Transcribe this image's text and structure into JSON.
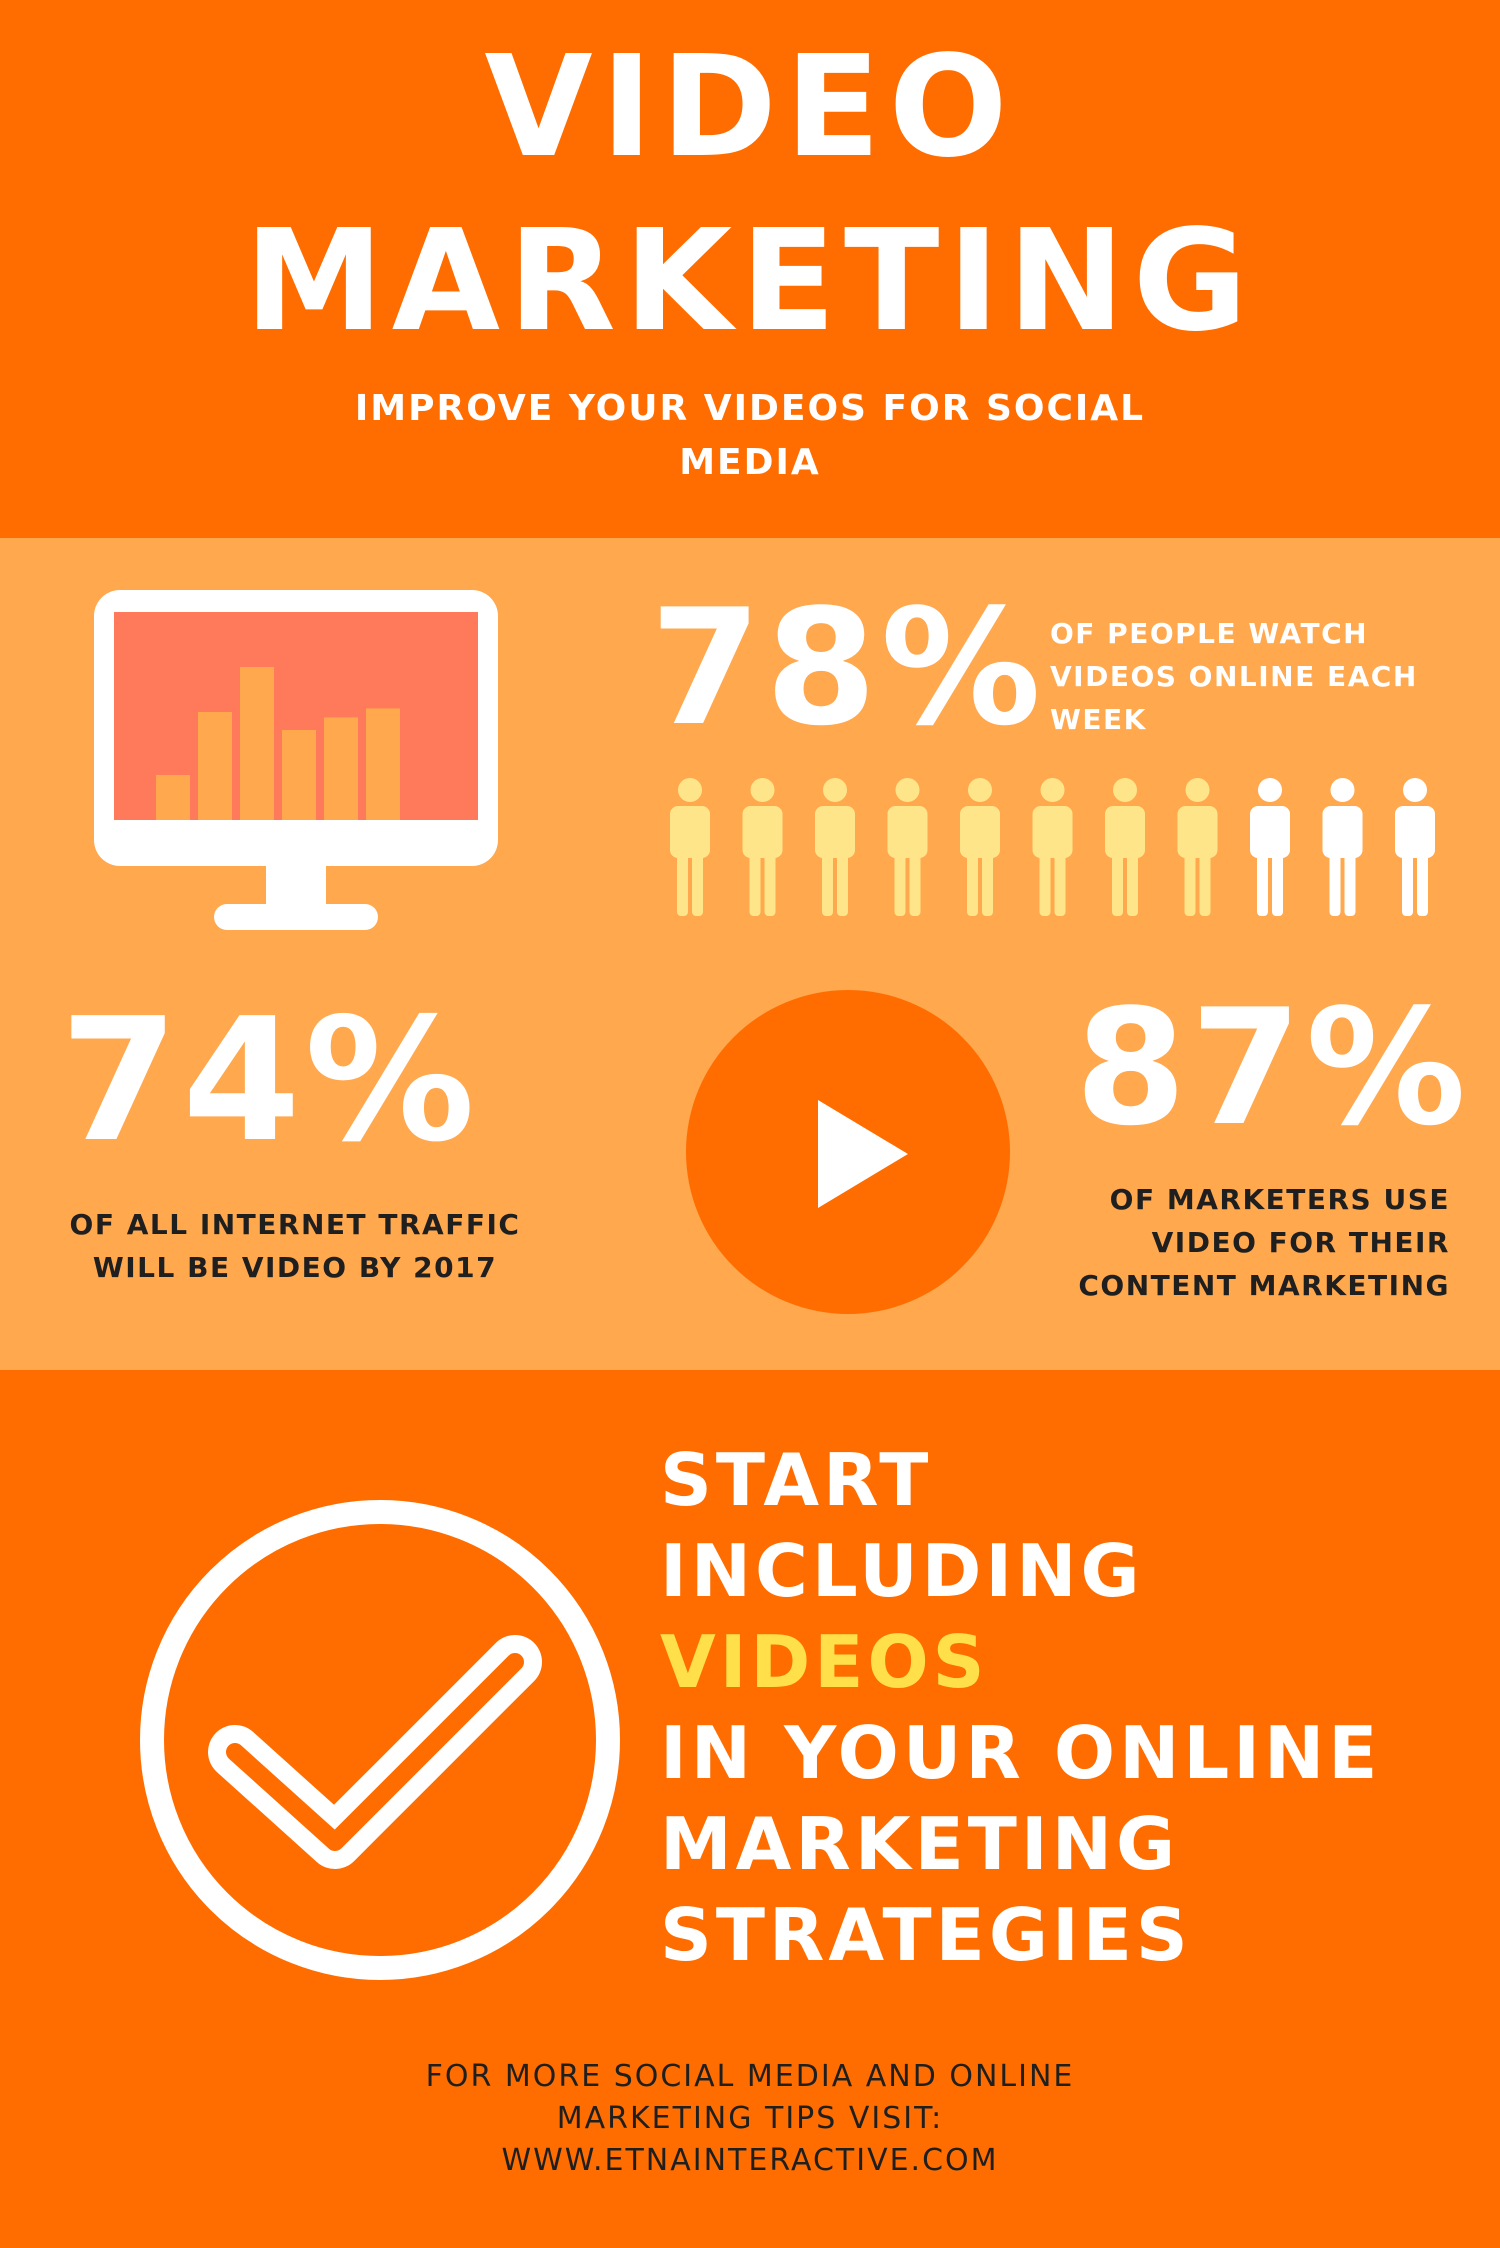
{
  "header": {
    "title_line_1": "VIDEO",
    "title_line_2": "MARKETING",
    "subtitle": "IMPROVE YOUR VIDEOS FOR SOCIAL MEDIA"
  },
  "stats": {
    "people_watch": {
      "value": "78%",
      "description": "OF PEOPLE WATCH VIDEOS ONLINE EACH WEEK",
      "figures_total": 11,
      "figures_highlighted": 8
    },
    "internet_traffic": {
      "value": "74%",
      "description": "OF ALL INTERNET TRAFFIC WILL BE VIDEO BY 2017"
    },
    "marketers": {
      "value": "87%",
      "description": "OF MARKETERS USE VIDEO FOR THEIR CONTENT MARKETING"
    }
  },
  "monitor_chart": {
    "bar_levels": [
      0.25,
      0.6,
      0.85,
      0.5,
      0.57,
      0.62
    ]
  },
  "cta": {
    "line_1": "START",
    "line_2": "INCLUDING",
    "line_3": "VIDEOS",
    "line_4": "IN YOUR ONLINE",
    "line_5": "MARKETING",
    "line_6": "STRATEGIES"
  },
  "footer": {
    "line_1": "FOR MORE SOCIAL MEDIA AND ONLINE",
    "line_2": "MARKETING TIPS VISIT:",
    "line_3": "WWW.ETNAINTERACTIVE.COM"
  },
  "icons": [
    "monitor-icon",
    "person-icon",
    "play-icon",
    "checkmark-icon"
  ],
  "colors": {
    "primary_orange": "#ff6d00",
    "light_orange": "#ffa84e",
    "screen_red": "#ff7a5a",
    "bar_orange": "#ffa84e",
    "highlight_yellow": "#ffe04a",
    "figure_yellow": "#ffe58a",
    "white": "#ffffff",
    "dark_text": "#1f1f1f"
  }
}
